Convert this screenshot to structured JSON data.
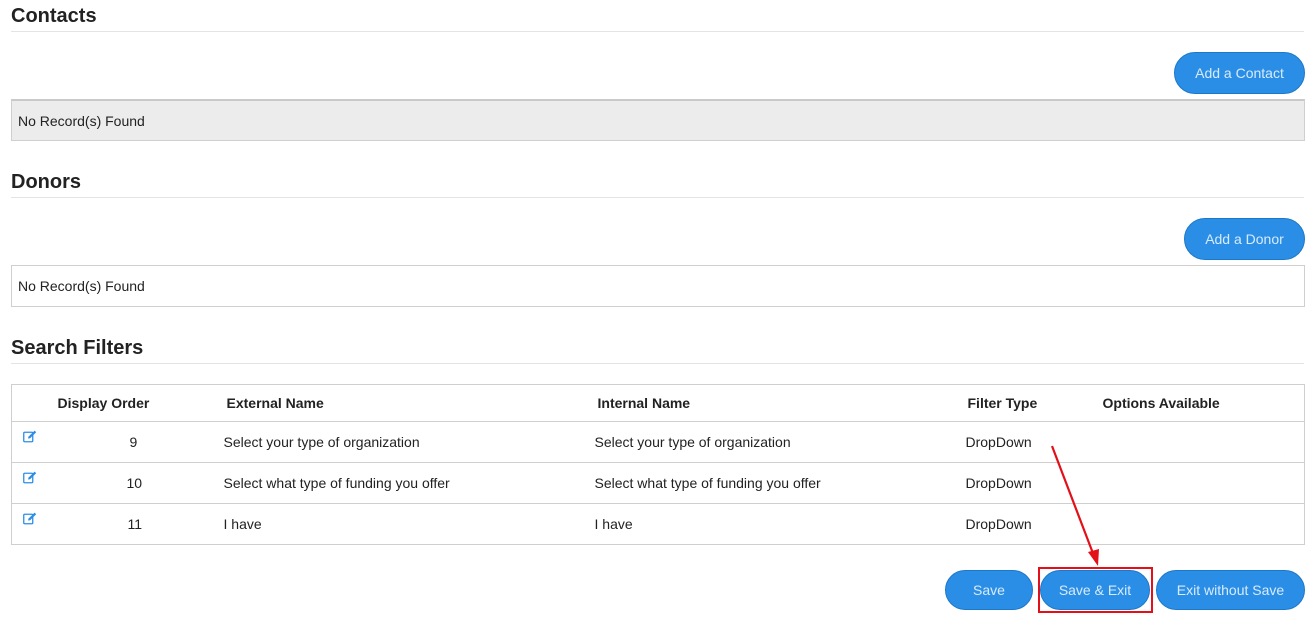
{
  "contacts": {
    "title": "Contacts",
    "add_button": "Add a Contact",
    "empty_text": "No Record(s) Found"
  },
  "donors": {
    "title": "Donors",
    "add_button": "Add a Donor",
    "empty_text": "No Record(s) Found"
  },
  "search_filters": {
    "title": "Search Filters",
    "headers": {
      "display_order": "Display Order",
      "external_name": "External Name",
      "internal_name": "Internal Name",
      "filter_type": "Filter Type",
      "options_available": "Options Available"
    },
    "rows": [
      {
        "display_order": "9",
        "external_name": "Select your type of organization",
        "internal_name": "Select your type of organization",
        "filter_type": "DropDown",
        "options_available": ""
      },
      {
        "display_order": "10",
        "external_name": "Select what type of funding you offer",
        "internal_name": "Select what type of funding you offer",
        "filter_type": "DropDown",
        "options_available": ""
      },
      {
        "display_order": "11",
        "external_name": "I have",
        "internal_name": "I have",
        "filter_type": "DropDown",
        "options_available": ""
      }
    ]
  },
  "footer": {
    "save": "Save",
    "save_exit": "Save & Exit",
    "exit_without_save": "Exit without Save"
  },
  "colors": {
    "button_blue": "#2b8ee6",
    "annotation_red": "#e3101a"
  },
  "icons": {
    "row_edit": "edit-icon"
  }
}
